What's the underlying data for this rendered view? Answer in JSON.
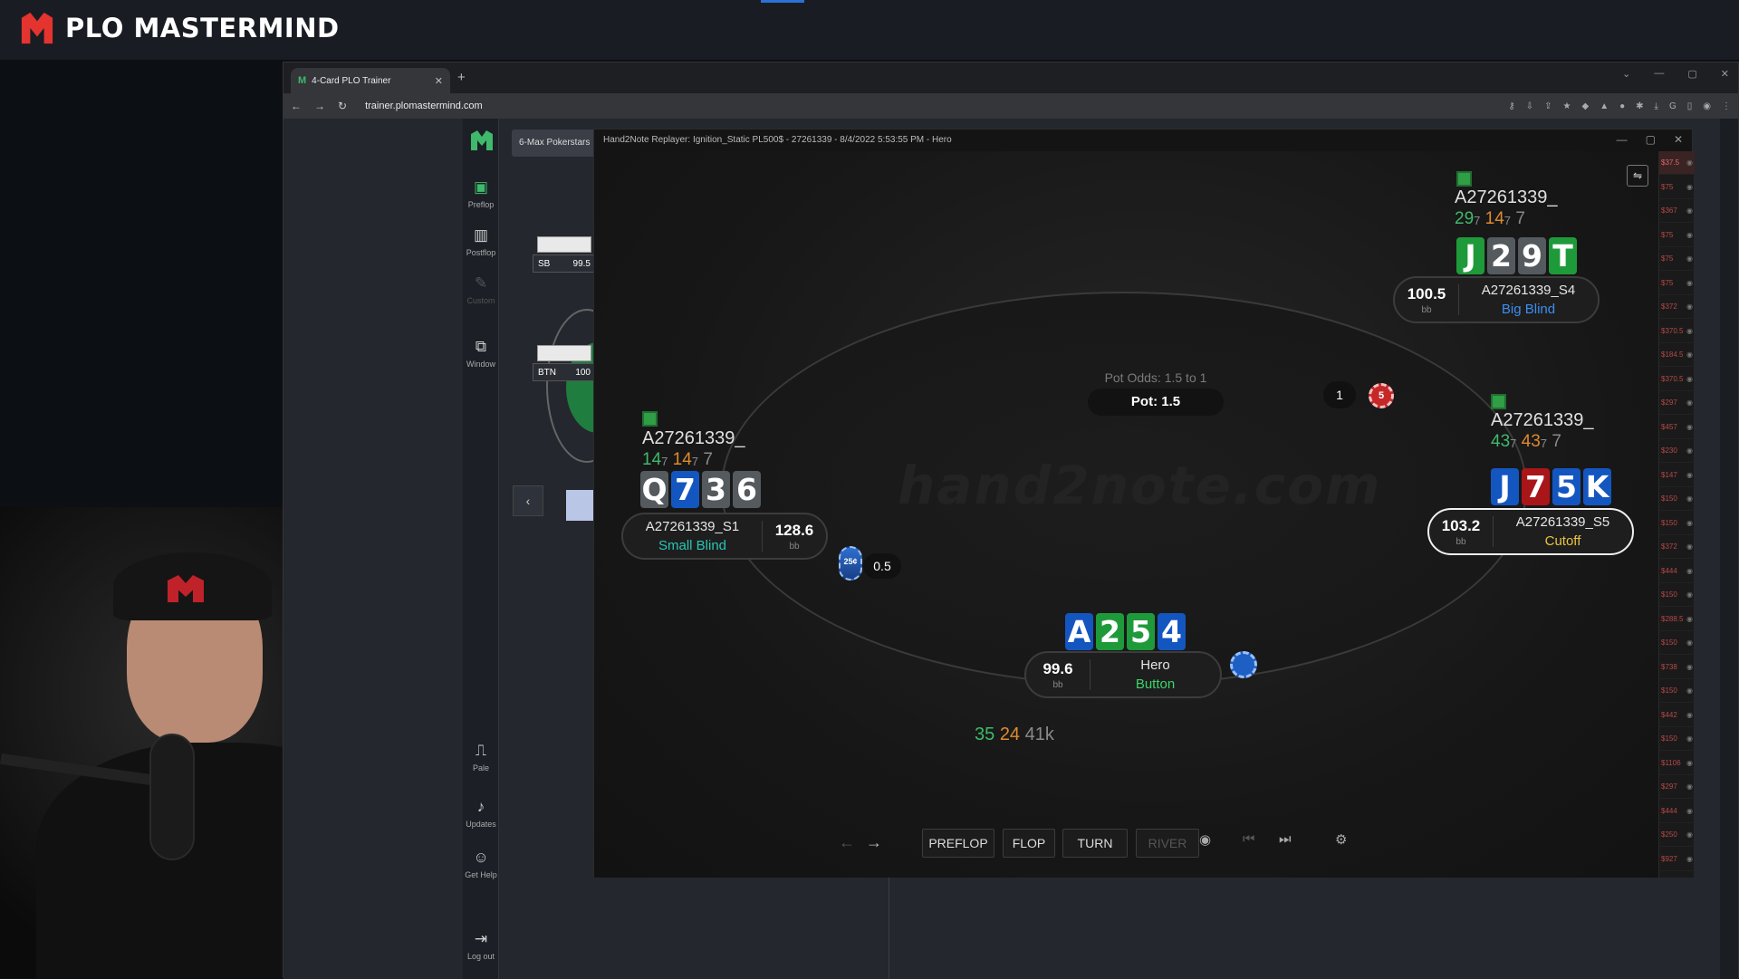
{
  "stream": {
    "brand_text": "PLO MASTERMIND"
  },
  "browser": {
    "tab_title": "4-Card PLO Trainer",
    "url": "trainer.plomastermind.com"
  },
  "app_sidebar": {
    "items": [
      {
        "label": "Preflop",
        "icon": "preflop-icon"
      },
      {
        "label": "Postflop",
        "icon": "postflop-icon"
      },
      {
        "label": "Custom",
        "icon": "custom-icon"
      },
      {
        "label": "Window",
        "icon": "window-icon"
      },
      {
        "label": "Pale",
        "icon": "paint-roller-icon"
      },
      {
        "label": "Updates",
        "icon": "bell-icon"
      },
      {
        "label": "Get Help",
        "icon": "discord-icon"
      },
      {
        "label": "Log out",
        "icon": "logout-icon"
      }
    ]
  },
  "background_app": {
    "tab_label": "6-Max Pokerstars",
    "sb_label": "SB",
    "sb_value": "99.5",
    "btn_label": "BTN",
    "btn_value": "100"
  },
  "replayer": {
    "title": "Hand2Note Replayer: Ignition_Static PL500$ - 27261339 - 8/4/2022 5:53:55 PM - Hero",
    "watermark": "hand2note.com",
    "pot_odds": "Pot Odds: 1.5 to 1",
    "pot": "Pot: 1.5",
    "round_badge": "1",
    "dealer_chip": "5",
    "players": {
      "bb": {
        "name_top": "A27261339_",
        "stats": [
          "29",
          "7",
          "14",
          "7",
          "7"
        ],
        "cards": [
          "J",
          "2",
          "9",
          "T"
        ],
        "stack": "100.5",
        "unit": "bb",
        "name": "A27261339_S4",
        "position": "Big Blind"
      },
      "co": {
        "name_top": "A27261339_",
        "stats": [
          "43",
          "7",
          "43",
          "7",
          "7"
        ],
        "cards": [
          "J",
          "7",
          "5",
          "K"
        ],
        "stack": "103.2",
        "unit": "bb",
        "name": "A27261339_S5",
        "position": "Cutoff"
      },
      "sb": {
        "name_top": "A27261339_",
        "stats": [
          "14",
          "7",
          "14",
          "7",
          "7"
        ],
        "cards": [
          "Q",
          "7",
          "3",
          "6"
        ],
        "stack": "128.6",
        "unit": "bb",
        "name": "A27261339_S1",
        "position": "Small Blind",
        "bet_chip": "25¢",
        "bet": "0.5"
      },
      "hero": {
        "cards": [
          "A",
          "2",
          "5",
          "4"
        ],
        "stack": "99.6",
        "unit": "bb",
        "name": "Hero",
        "position": "Button",
        "stats": [
          "35",
          "24",
          "41k"
        ]
      }
    },
    "toolbar": {
      "streets": [
        "PREFLOP",
        "FLOP",
        "TURN",
        "RIVER"
      ]
    },
    "money_column": [
      "$37.5",
      "$75",
      "$367",
      "$75",
      "$75",
      "$75",
      "$372",
      "$370.5",
      "$184.5",
      "$370.5",
      "$297",
      "$457",
      "$230",
      "$147",
      "$150",
      "$150",
      "$372",
      "$444",
      "$150",
      "$288.5",
      "$150",
      "$738",
      "$150",
      "$442",
      "$150",
      "$1106",
      "$297",
      "$444",
      "$250",
      "$927"
    ]
  },
  "colors": {
    "accent_green": "#3fb96b",
    "brand_red": "#e3342f",
    "card_blue": "#1456c0",
    "card_red": "#a8161a"
  }
}
